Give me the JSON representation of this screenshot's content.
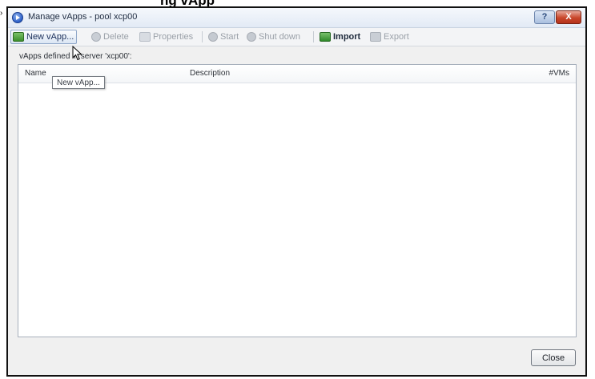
{
  "caption": {
    "text": "ng vApp"
  },
  "window": {
    "title": "Manage vApps - pool xcp00",
    "help_glyph": "?",
    "close_glyph": "X"
  },
  "toolbar": {
    "new_vapp": "New vApp...",
    "delete": "Delete",
    "properties": "Properties",
    "start": "Start",
    "shut_down": "Shut down",
    "import": "Import",
    "export": "Export"
  },
  "main": {
    "section_label": "vApps defined in server 'xcp00':",
    "columns": [
      "Name",
      "Description",
      "#VMs"
    ],
    "rows": [],
    "tooltip": "New vApp..."
  },
  "footer": {
    "close_label": "Close"
  }
}
